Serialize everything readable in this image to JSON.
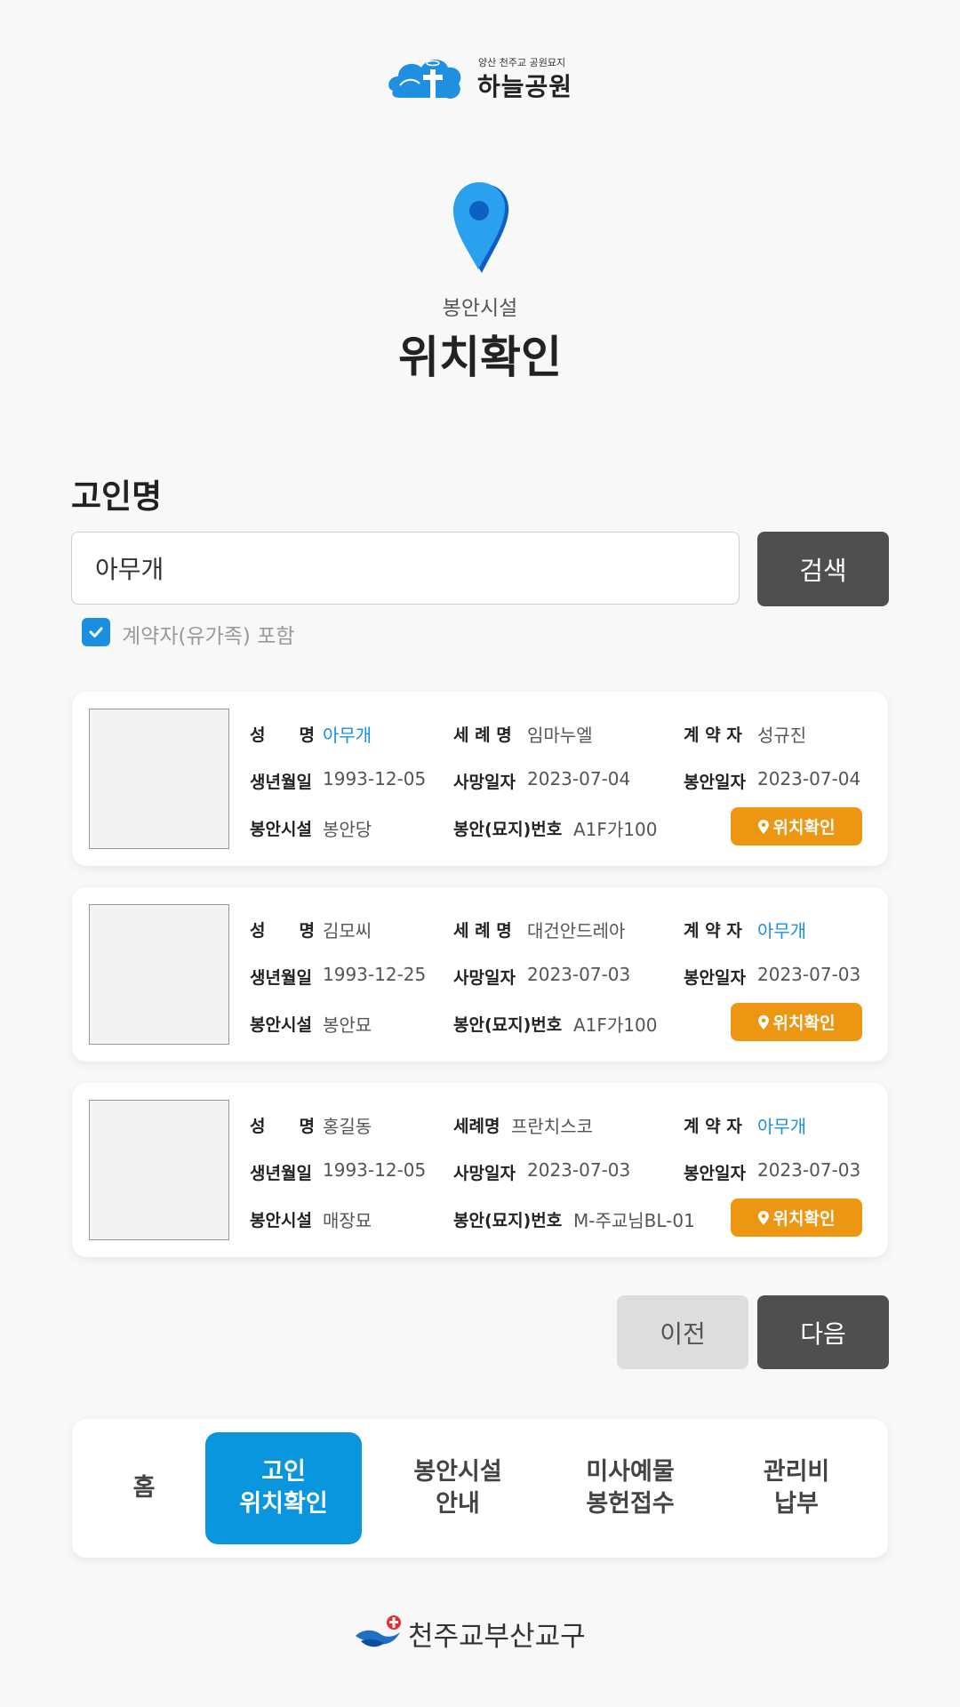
{
  "header": {
    "logo_small": "양산 천주교 공원묘지",
    "logo_big": "하늘공원",
    "subtitle": "봉안시설",
    "title": "위치확인"
  },
  "search": {
    "label": "고인명",
    "value": "아무개",
    "button": "검색",
    "checkbox_label": "계약자(유가족) 포함",
    "checkbox_checked": true
  },
  "labels": {
    "name": "성　　명",
    "baptism": "세 례 명",
    "baptism_alt": "세례명",
    "contractor": "계 약 자",
    "birth": "생년월일",
    "death": "사망일자",
    "enshrined": "봉안일자",
    "facility": "봉안시설",
    "number": "봉안(묘지)번호"
  },
  "results": [
    {
      "name": "아무개",
      "baptism": "임마누엘",
      "contractor": "성규진",
      "birth": "1993-12-05",
      "death": "2023-07-04",
      "enshrined": "2023-07-04",
      "facility": "봉안당",
      "number": "A1F가100",
      "button": "위치확인"
    },
    {
      "name": "김모씨",
      "baptism": "대건안드레아",
      "contractor": "아무개",
      "birth": "1993-12-25",
      "death": "2023-07-03",
      "enshrined": "2023-07-03",
      "facility": "봉안묘",
      "number": "A1F가100",
      "button": "위치확인"
    },
    {
      "name": "홍길동",
      "baptism": "프란치스코",
      "contractor": "아무개",
      "birth": "1993-12-05",
      "death": "2023-07-03",
      "enshrined": "2023-07-03",
      "facility": "매장묘",
      "number": "M-주교님BL-01",
      "button": "위치확인"
    }
  ],
  "pagination": {
    "prev": "이전",
    "next": "다음"
  },
  "nav": {
    "items": [
      {
        "line1": "홈",
        "line2": ""
      },
      {
        "line1": "고인",
        "line2": "위치확인"
      },
      {
        "line1": "봉안시설",
        "line2": "안내"
      },
      {
        "line1": "미사예물",
        "line2": "봉헌접수"
      },
      {
        "line1": "관리비",
        "line2": "납부"
      }
    ],
    "active_index": 1
  },
  "footer": {
    "text": "천주교부산교구"
  },
  "colors": {
    "accent": "#0a95df",
    "highlight_text": "#1a8fe0",
    "location_button": "#ec9612",
    "dark_button": "#4f4f4f"
  }
}
